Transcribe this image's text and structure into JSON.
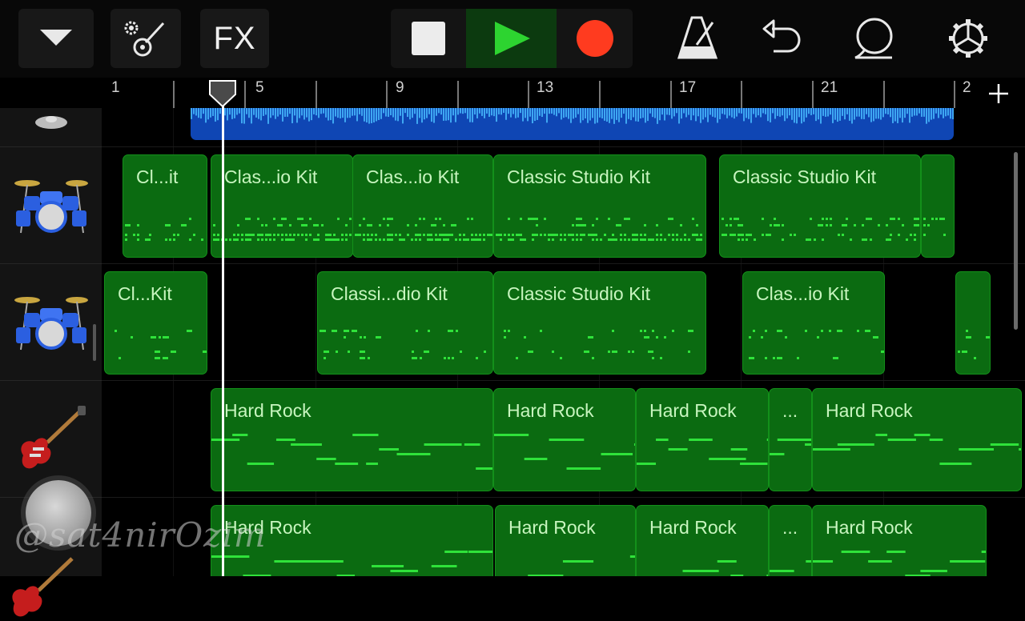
{
  "toolbar": {
    "fx_label": "FX",
    "icons": [
      "chevron-down-icon",
      "instrument-settings-icon",
      "play-icon",
      "stop-icon",
      "record-icon",
      "metronome-icon",
      "undo-icon",
      "loop-icon",
      "settings-icon"
    ]
  },
  "transport": {
    "play_color": "#2dd430",
    "record_color": "#ff3b1f",
    "stop_color": "#e8e8e8"
  },
  "ruler": {
    "bars": [
      "1",
      "5",
      "9",
      "13",
      "17",
      "21",
      "2"
    ]
  },
  "tracks": [
    {
      "instrument": "cymbal",
      "regions": []
    },
    {
      "instrument": "drum-kit",
      "regions": [
        {
          "name": "Cl...it"
        },
        {
          "name": "Clas...io Kit"
        },
        {
          "name": "Clas...io Kit"
        },
        {
          "name": "Classic Studio Kit"
        },
        {
          "name": "Classic Studio Kit"
        },
        {
          "name": ""
        }
      ]
    },
    {
      "instrument": "drum-kit",
      "regions": [
        {
          "name": "Cl...Kit"
        },
        {
          "name": "Classi...dio Kit"
        },
        {
          "name": "Classic Studio Kit"
        },
        {
          "name": "Clas...io Kit"
        },
        {
          "name": ""
        }
      ]
    },
    {
      "instrument": "electric-guitar",
      "regions": [
        {
          "name": "Hard Rock"
        },
        {
          "name": "Hard Rock"
        },
        {
          "name": "Hard Rock"
        },
        {
          "name": "..."
        },
        {
          "name": "Hard Rock"
        }
      ]
    },
    {
      "instrument": "electric-guitar",
      "regions": [
        {
          "name": "Hard Rock"
        },
        {
          "name": "Hard Rock"
        },
        {
          "name": "Hard Rock"
        },
        {
          "name": "..."
        },
        {
          "name": "Hard Rock"
        }
      ]
    }
  ],
  "watermark": "@sat4nirOzim",
  "colors": {
    "region": "#0b6b11",
    "notes": "#2fe23a",
    "audio": "#0f46b4",
    "waveform": "#3ea7f2"
  }
}
